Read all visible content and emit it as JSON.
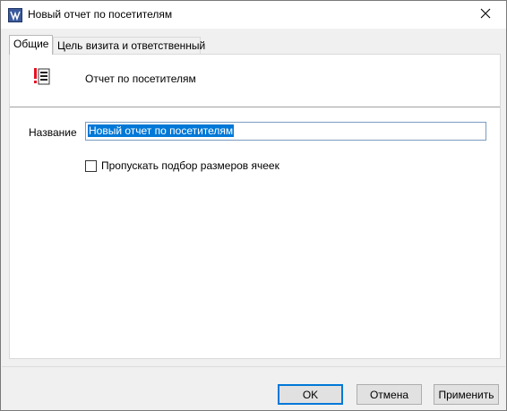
{
  "window": {
    "title": "Новый отчет по посетителям",
    "icons": {
      "app": "app-logo-icon",
      "close": "close-icon"
    }
  },
  "tabs": [
    {
      "label": "Общие",
      "active": true
    },
    {
      "label": "Цель визита и ответственный",
      "active": false
    }
  ],
  "general": {
    "report_type_label": "Отчет по посетителям",
    "report_icon": "report-list-icon",
    "name_label": "Название",
    "name_value": "Новый отчет по посетителям",
    "skip_sizing_label": "Пропускать подбор размеров ячеек",
    "skip_sizing_checked": false
  },
  "buttons": {
    "ok": "OK",
    "cancel": "Отмена",
    "apply": "Применить"
  },
  "colors": {
    "accent": "#0078d7",
    "report_icon_red": "#e81123"
  }
}
